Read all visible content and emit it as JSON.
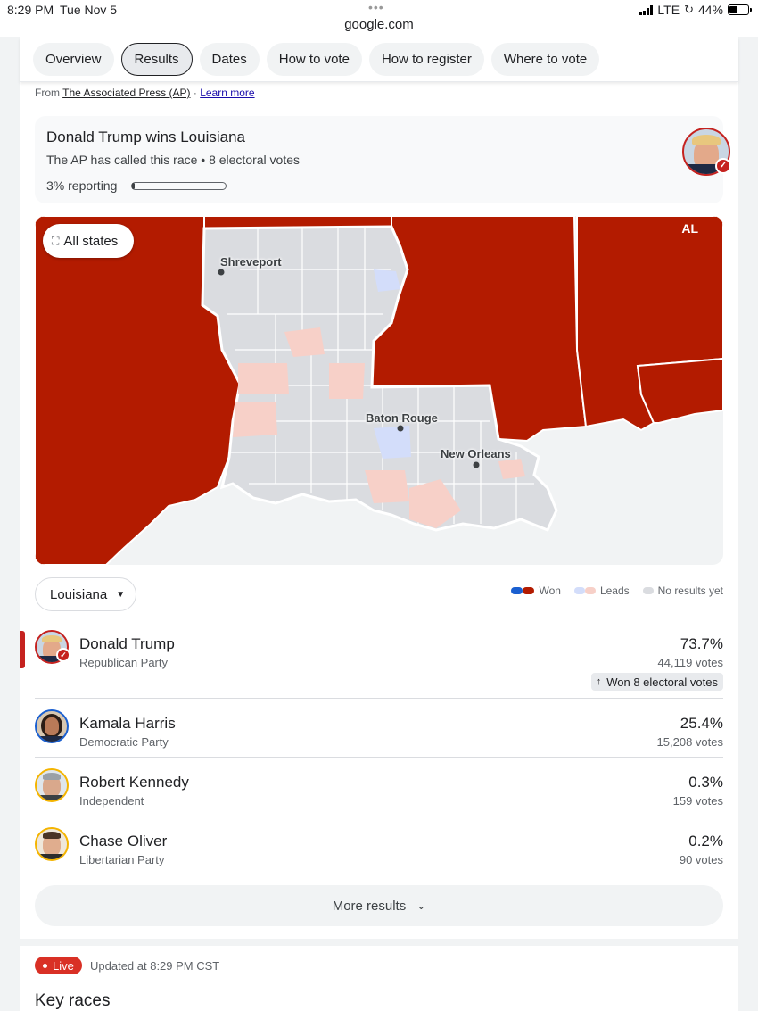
{
  "status": {
    "time": "8:29 PM",
    "date": "Tue Nov 5",
    "url": "google.com",
    "network": "LTE",
    "battery": "44%",
    "battery_level": 0.44
  },
  "tabs": [
    "Overview",
    "Results",
    "Dates",
    "How to vote",
    "How to register",
    "Where to vote"
  ],
  "active_tab": "Results",
  "source": {
    "prefix": "From",
    "publisher": "The Associated Press (AP)",
    "sep": "·",
    "learn_more": "Learn more"
  },
  "winner": {
    "title": "Donald Trump wins Louisiana",
    "subtitle": "The AP has called this race • 8 electoral votes",
    "reporting": "3% reporting",
    "reporting_fraction": 0.03
  },
  "map": {
    "all_states": "All states",
    "neighbor_label": "AL",
    "cities": [
      "Shreveport",
      "Baton Rouge",
      "New Orleans"
    ]
  },
  "state_select": "Louisiana",
  "legend": {
    "won": "Won",
    "leads": "Leads",
    "no_results": "No results yet"
  },
  "candidates": [
    {
      "name": "Donald Trump",
      "party": "Republican Party",
      "pct": "73.7%",
      "votes": "44,119 votes",
      "badge": "Won 8 electoral votes"
    },
    {
      "name": "Kamala Harris",
      "party": "Democratic Party",
      "pct": "25.4%",
      "votes": "15,208 votes"
    },
    {
      "name": "Robert Kennedy",
      "party": "Independent",
      "pct": "0.3%",
      "votes": "159 votes"
    },
    {
      "name": "Chase Oliver",
      "party": "Libertarian Party",
      "pct": "0.2%",
      "votes": "90 votes"
    }
  ],
  "more_results": "More results",
  "live": {
    "label": "Live",
    "updated": "Updated at 8:29 PM CST",
    "heading": "Key races"
  },
  "colors": {
    "republican": "#b31b00",
    "democrat": "#1a5fd0",
    "lead_red": "#f7d0c8",
    "lead_blue": "#d3ddfa",
    "no_results": "#dadce0",
    "ocean": "#f1f3f4"
  }
}
